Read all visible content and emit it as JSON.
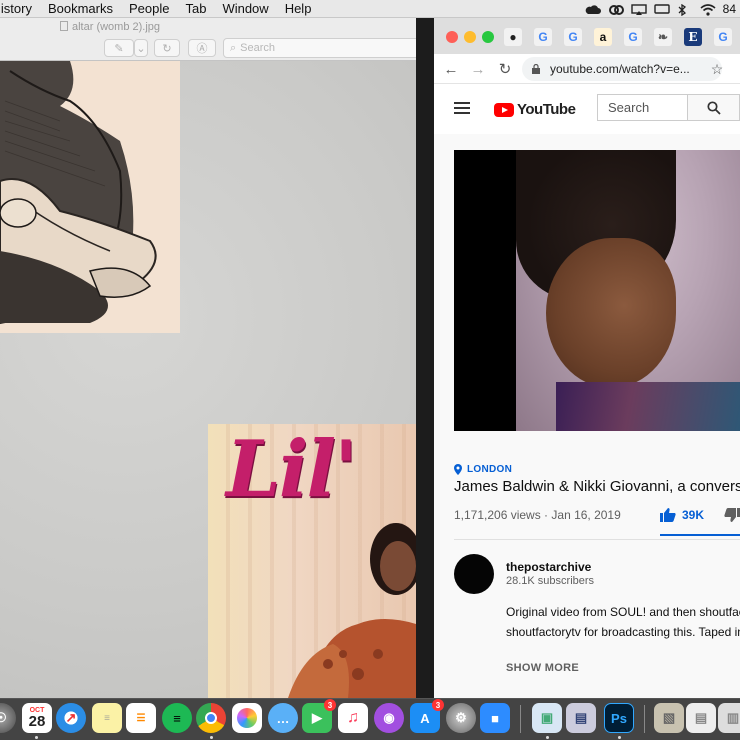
{
  "menubar": {
    "items": [
      "listory",
      "Bookmarks",
      "People",
      "Tab",
      "Window",
      "Help"
    ],
    "battery_text": "84"
  },
  "preview": {
    "title": "altar (womb 2).jpg",
    "search_placeholder": "Search",
    "album_text": "Lil'"
  },
  "chrome": {
    "url": "youtube.com/watch?v=e...",
    "tabs": [
      "globe",
      "G",
      "G",
      "a",
      "G",
      "feather",
      "E",
      "G"
    ]
  },
  "youtube": {
    "search_placeholder": "Search",
    "logo_text": "YouTube",
    "location": "LONDON",
    "title": "James Baldwin & Nikki Giovanni, a conversati",
    "views": "1,171,206 views · Jan 16, 2019",
    "likes": "39K",
    "channel_name": "thepostarchive",
    "subscribers": "28.1K subscribers",
    "description_line1": "Original video from SOUL! and then shoutfacto",
    "description_line2": "shoutfactorytv for broadcasting this. Taped in",
    "show_more": "SHOW MORE"
  },
  "dock": {
    "calendar_month": "OCT",
    "calendar_day": "28",
    "facetime_badge": "3",
    "appstore_badge": "3",
    "photoshop_label": "Ps"
  }
}
